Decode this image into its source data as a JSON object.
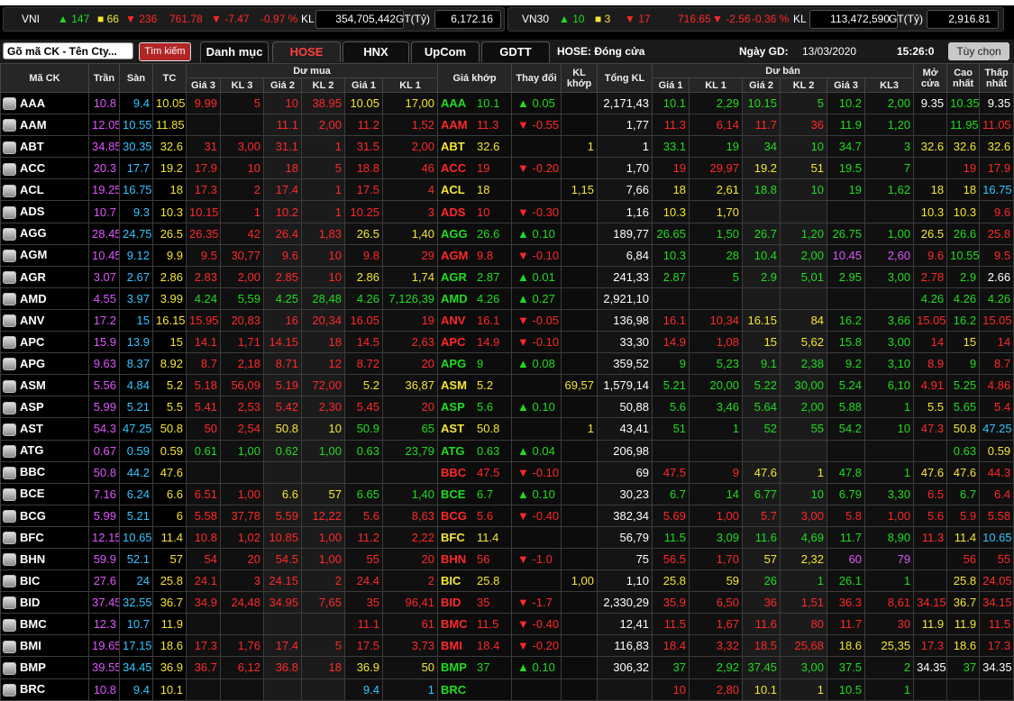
{
  "indices": [
    {
      "name": "VNI",
      "up": "147",
      "ref": "66",
      "down": "236",
      "value": "761.78",
      "change": "▼ -7.47",
      "pct": "-0.97 %",
      "kl_label": "KL",
      "volume": "354,705,442",
      "gt_label": "GT(Tỷ)",
      "gt": "6,172.16"
    },
    {
      "name": "VN30",
      "up": "10",
      "ref": "3",
      "down": "17",
      "value": "716.65",
      "change": "▼ -2.56",
      "pct": "-0.36 %",
      "kl_label": "KL",
      "volume": "113,472,590",
      "gt_label": "GT(Tỷ)",
      "gt": "2,916.81"
    }
  ],
  "toolbar": {
    "search_placeholder": "Gõ mã CK - Tên Cty...",
    "search_button": "Tìm kiếm",
    "tabs": [
      "Danh mục",
      "HOSE",
      "HNX",
      "UpCom",
      "GDTT"
    ],
    "active_tab": "HOSE",
    "status": "HOSE:  Đóng cửa",
    "date_label": "Ngày GD:",
    "date": "13/03/2020",
    "time": "15:26:0",
    "options_button": "Tùy chọn"
  },
  "headers": {
    "symbol": "Mã CK",
    "ceil": "Trần",
    "floor": "Sàn",
    "ref": "TC",
    "buy_group": "Dư mua",
    "sell_group": "Dư bán",
    "price": "Giá 3",
    "vol3": "KL 3",
    "price2": "Giá 2",
    "vol2": "KL 2",
    "price1": "Giá 1",
    "vol1": "KL 1",
    "match_price": "Giá khớp",
    "change": "Thay đổi",
    "match_vol": "KL khớp",
    "total_vol": "Tổng KL",
    "s_price1": "Giá 1",
    "s_vol1": "KL 1",
    "s_price2": "Giá 2",
    "s_vol2": "KL 2",
    "s_price3": "Giá 3",
    "s_vol3": "KL3",
    "open": "Mở cửa",
    "high": "Cao nhất",
    "low": "Thấp nhất"
  },
  "colors": {
    "up": "#1fdc1f",
    "down": "#ff2828",
    "ref": "#f5e633",
    "ceil": "#e055ff",
    "floor": "#33c5ff",
    "white": "#ffffff"
  },
  "rows": [
    {
      "s": "AAA",
      "c": "10.8",
      "f": "9.4",
      "r": "10.05",
      "b3": "9.99",
      "v3": "5",
      "b2": "10",
      "v2": "38.95",
      "b1": "10.05",
      "v1": "17,00",
      "p": "10.1",
      "ch": "▲ 0.05",
      "kl": "",
      "t": "2,171,43",
      "a1": "10.1",
      "w1": "2,29",
      "a2": "10.15",
      "w2": "5",
      "a3": "10.2",
      "w3": "2,00",
      "o": "9.35",
      "h": "10.35",
      "l": "9.35",
      "cs": "up",
      "cb3": "dn",
      "cb2": "dn",
      "cb1": "rf",
      "ca1": "up",
      "ca2": "up",
      "ca3": "up",
      "co": "wh",
      "chh": "up",
      "cl": "wh"
    },
    {
      "s": "AAM",
      "c": "12.05",
      "f": "10.55",
      "r": "11.85",
      "b3": "",
      "v3": "",
      "b2": "11.1",
      "v2": "2,00",
      "b1": "11.2",
      "v1": "1,52",
      "p": "11.3",
      "ch": "▼ -0.55",
      "kl": "",
      "t": "1,77",
      "a1": "11.3",
      "w1": "6,14",
      "a2": "11.7",
      "w2": "36",
      "a3": "11.9",
      "w3": "1,20",
      "o": "",
      "h": "11.95",
      "l": "11.05",
      "cs": "dn",
      "cb3": "dn",
      "cb2": "dn",
      "cb1": "dn",
      "ca1": "dn",
      "ca2": "dn",
      "ca3": "up",
      "co": "wh",
      "chh": "up",
      "cl": "dn"
    },
    {
      "s": "ABT",
      "c": "34.85",
      "f": "30.35",
      "r": "32.6",
      "b3": "31",
      "v3": "3,00",
      "b2": "31.1",
      "v2": "1",
      "b1": "31.5",
      "v1": "2,00",
      "p": "32.6",
      "ch": "",
      "kl": "1",
      "t": "1",
      "a1": "33.1",
      "w1": "19",
      "a2": "34",
      "w2": "10",
      "a3": "34.7",
      "w3": "3",
      "o": "32.6",
      "h": "32.6",
      "l": "32.6",
      "cs": "rf",
      "cb3": "dn",
      "cb2": "dn",
      "cb1": "dn",
      "ca1": "up",
      "ca2": "up",
      "ca3": "up",
      "co": "rf",
      "chh": "rf",
      "cl": "rf"
    },
    {
      "s": "ACC",
      "c": "20.3",
      "f": "17.7",
      "r": "19.2",
      "b3": "17.9",
      "v3": "10",
      "b2": "18",
      "v2": "5",
      "b1": "18.8",
      "v1": "46",
      "p": "19",
      "ch": "▼ -0.20",
      "kl": "",
      "t": "1,70",
      "a1": "19",
      "w1": "29,97",
      "a2": "19.2",
      "w2": "51",
      "a3": "19.5",
      "w3": "7",
      "o": "",
      "h": "19",
      "l": "17.9",
      "cs": "dn",
      "cb3": "dn",
      "cb2": "dn",
      "cb1": "dn",
      "ca1": "dn",
      "ca2": "rf",
      "ca3": "up",
      "co": "wh",
      "chh": "dn",
      "cl": "dn"
    },
    {
      "s": "ACL",
      "c": "19.25",
      "f": "16.75",
      "r": "18",
      "b3": "17.3",
      "v3": "2",
      "b2": "17.4",
      "v2": "1",
      "b1": "17.5",
      "v1": "4",
      "p": "18",
      "ch": "",
      "kl": "1,15",
      "t": "7,66",
      "a1": "18",
      "w1": "2,61",
      "a2": "18.8",
      "w2": "10",
      "a3": "19",
      "w3": "1,62",
      "o": "18",
      "h": "18",
      "l": "16.75",
      "cs": "rf",
      "cb3": "dn",
      "cb2": "dn",
      "cb1": "dn",
      "ca1": "rf",
      "ca2": "up",
      "ca3": "up",
      "co": "rf",
      "chh": "rf",
      "cl": "fl"
    },
    {
      "s": "ADS",
      "c": "10.7",
      "f": "9.3",
      "r": "10.3",
      "b3": "10.15",
      "v3": "1",
      "b2": "10.2",
      "v2": "1",
      "b1": "10.25",
      "v1": "3",
      "p": "10",
      "ch": "▼ -0.30",
      "kl": "",
      "t": "1,16",
      "a1": "10.3",
      "w1": "1,70",
      "a2": "",
      "w2": "",
      "a3": "",
      "w3": "",
      "o": "10.3",
      "h": "10.3",
      "l": "9.6",
      "cs": "dn",
      "cb3": "dn",
      "cb2": "dn",
      "cb1": "dn",
      "ca1": "rf",
      "ca2": "wh",
      "ca3": "wh",
      "co": "rf",
      "chh": "rf",
      "cl": "dn"
    },
    {
      "s": "AGG",
      "c": "28.45",
      "f": "24.75",
      "r": "26.5",
      "b3": "26.35",
      "v3": "42",
      "b2": "26.4",
      "v2": "1,83",
      "b1": "26.5",
      "v1": "1,40",
      "p": "26.6",
      "ch": "▲ 0.10",
      "kl": "",
      "t": "189,77",
      "a1": "26.65",
      "w1": "1,50",
      "a2": "26.7",
      "w2": "1,20",
      "a3": "26.75",
      "w3": "1,00",
      "o": "26.5",
      "h": "26.6",
      "l": "25.8",
      "cs": "up",
      "cb3": "dn",
      "cb2": "dn",
      "cb1": "rf",
      "ca1": "up",
      "ca2": "up",
      "ca3": "up",
      "co": "rf",
      "chh": "up",
      "cl": "dn"
    },
    {
      "s": "AGM",
      "c": "10.45",
      "f": "9.12",
      "r": "9.9",
      "b3": "9.5",
      "v3": "30,77",
      "b2": "9.6",
      "v2": "10",
      "b1": "9.8",
      "v1": "29",
      "p": "9.8",
      "ch": "▼ -0.10",
      "kl": "",
      "t": "6,84",
      "a1": "10.3",
      "w1": "28",
      "a2": "10.4",
      "w2": "2,00",
      "a3": "10.45",
      "w3": "2,60",
      "o": "9.6",
      "h": "10.55",
      "l": "9.5",
      "cs": "dn",
      "cb3": "dn",
      "cb2": "dn",
      "cb1": "dn",
      "ca1": "up",
      "ca2": "up",
      "ca3": "ce",
      "co": "dn",
      "chh": "up",
      "cl": "dn"
    },
    {
      "s": "AGR",
      "c": "3.07",
      "f": "2.67",
      "r": "2.86",
      "b3": "2.83",
      "v3": "2,00",
      "b2": "2.85",
      "v2": "10",
      "b1": "2.86",
      "v1": "1,74",
      "p": "2.87",
      "ch": "▲ 0.01",
      "kl": "",
      "t": "241,33",
      "a1": "2.87",
      "w1": "5",
      "a2": "2.9",
      "w2": "5,01",
      "a3": "2.95",
      "w3": "3,00",
      "o": "2.78",
      "h": "2.9",
      "l": "2.66",
      "cs": "up",
      "cb3": "dn",
      "cb2": "dn",
      "cb1": "rf",
      "ca1": "up",
      "ca2": "up",
      "ca3": "up",
      "co": "dn",
      "chh": "up",
      "cl": "wh"
    },
    {
      "s": "AMD",
      "c": "4.55",
      "f": "3.97",
      "r": "3.99",
      "b3": "4.24",
      "v3": "5,59",
      "b2": "4.25",
      "v2": "28,48",
      "b1": "4.26",
      "v1": "7,126,39",
      "p": "4.26",
      "ch": "▲ 0.27",
      "kl": "",
      "t": "2,921,10",
      "a1": "",
      "w1": "",
      "a2": "",
      "w2": "",
      "a3": "",
      "w3": "",
      "o": "4.26",
      "h": "4.26",
      "l": "4.26",
      "cs": "up",
      "cb3": "up",
      "cb2": "up",
      "cb1": "up",
      "ca1": "wh",
      "ca2": "wh",
      "ca3": "wh",
      "co": "up",
      "chh": "up",
      "cl": "up"
    },
    {
      "s": "ANV",
      "c": "17.2",
      "f": "15",
      "r": "16.15",
      "b3": "15.95",
      "v3": "20,83",
      "b2": "16",
      "v2": "20,34",
      "b1": "16.05",
      "v1": "19",
      "p": "16.1",
      "ch": "▼ -0.05",
      "kl": "",
      "t": "136,98",
      "a1": "16.1",
      "w1": "10,34",
      "a2": "16.15",
      "w2": "84",
      "a3": "16.2",
      "w3": "3,66",
      "o": "15.05",
      "h": "16.2",
      "l": "15.05",
      "cs": "dn",
      "cb3": "dn",
      "cb2": "dn",
      "cb1": "dn",
      "ca1": "dn",
      "ca2": "rf",
      "ca3": "up",
      "co": "dn",
      "chh": "up",
      "cl": "dn"
    },
    {
      "s": "APC",
      "c": "15.9",
      "f": "13.9",
      "r": "15",
      "b3": "14.1",
      "v3": "1,71",
      "b2": "14.15",
      "v2": "18",
      "b1": "14.5",
      "v1": "2,63",
      "p": "14.9",
      "ch": "▼ -0.10",
      "kl": "",
      "t": "33,30",
      "a1": "14.9",
      "w1": "1,08",
      "a2": "15",
      "w2": "5,62",
      "a3": "15.8",
      "w3": "3,00",
      "o": "14",
      "h": "15",
      "l": "14",
      "cs": "dn",
      "cb3": "dn",
      "cb2": "dn",
      "cb1": "dn",
      "ca1": "dn",
      "ca2": "rf",
      "ca3": "up",
      "co": "dn",
      "chh": "rf",
      "cl": "dn"
    },
    {
      "s": "APG",
      "c": "9.63",
      "f": "8.37",
      "r": "8.92",
      "b3": "8.7",
      "v3": "2,18",
      "b2": "8.71",
      "v2": "12",
      "b1": "8.72",
      "v1": "20",
      "p": "9",
      "ch": "▲ 0.08",
      "kl": "",
      "t": "359,52",
      "a1": "9",
      "w1": "5,23",
      "a2": "9.1",
      "w2": "2,38",
      "a3": "9.2",
      "w3": "3,10",
      "o": "8.9",
      "h": "9",
      "l": "8.7",
      "cs": "up",
      "cb3": "dn",
      "cb2": "dn",
      "cb1": "dn",
      "ca1": "up",
      "ca2": "up",
      "ca3": "up",
      "co": "dn",
      "chh": "up",
      "cl": "dn"
    },
    {
      "s": "ASM",
      "c": "5.56",
      "f": "4.84",
      "r": "5.2",
      "b3": "5.18",
      "v3": "56,09",
      "b2": "5.19",
      "v2": "72,00",
      "b1": "5.2",
      "v1": "36,87",
      "p": "5.2",
      "ch": "",
      "kl": "69,57",
      "t": "1,579,14",
      "a1": "5.21",
      "w1": "20,00",
      "a2": "5.22",
      "w2": "30,00",
      "a3": "5.24",
      "w3": "6,10",
      "o": "4.91",
      "h": "5.25",
      "l": "4.86",
      "cs": "rf",
      "cb3": "dn",
      "cb2": "dn",
      "cb1": "rf",
      "ca1": "up",
      "ca2": "up",
      "ca3": "up",
      "co": "dn",
      "chh": "up",
      "cl": "dn"
    },
    {
      "s": "ASP",
      "c": "5.99",
      "f": "5.21",
      "r": "5.5",
      "b3": "5.41",
      "v3": "2,53",
      "b2": "5.42",
      "v2": "2,30",
      "b1": "5.45",
      "v1": "20",
      "p": "5.6",
      "ch": "▲ 0.10",
      "kl": "",
      "t": "50,88",
      "a1": "5.6",
      "w1": "3,46",
      "a2": "5.64",
      "w2": "2,00",
      "a3": "5.88",
      "w3": "1",
      "o": "5.5",
      "h": "5.65",
      "l": "5.4",
      "cs": "up",
      "cb3": "dn",
      "cb2": "dn",
      "cb1": "dn",
      "ca1": "up",
      "ca2": "up",
      "ca3": "up",
      "co": "rf",
      "chh": "up",
      "cl": "dn"
    },
    {
      "s": "AST",
      "c": "54.3",
      "f": "47.25",
      "r": "50.8",
      "b3": "50",
      "v3": "2,54",
      "b2": "50.8",
      "v2": "10",
      "b1": "50.9",
      "v1": "65",
      "p": "50.8",
      "ch": "",
      "kl": "1",
      "t": "43,41",
      "a1": "51",
      "w1": "1",
      "a2": "52",
      "w2": "55",
      "a3": "54.2",
      "w3": "10",
      "o": "47.3",
      "h": "50.8",
      "l": "47.25",
      "cs": "rf",
      "cb3": "dn",
      "cb2": "rf",
      "cb1": "up",
      "ca1": "up",
      "ca2": "up",
      "ca3": "up",
      "co": "dn",
      "chh": "rf",
      "cl": "fl"
    },
    {
      "s": "ATG",
      "c": "0.67",
      "f": "0.59",
      "r": "0.59",
      "b3": "0.61",
      "v3": "1,00",
      "b2": "0.62",
      "v2": "1,00",
      "b1": "0.63",
      "v1": "23,79",
      "p": "0.63",
      "ch": "▲ 0.04",
      "kl": "",
      "t": "206,98",
      "a1": "",
      "w1": "",
      "a2": "",
      "w2": "",
      "a3": "",
      "w3": "",
      "o": "",
      "h": "0.63",
      "l": "0.59",
      "cs": "up",
      "cb3": "up",
      "cb2": "up",
      "cb1": "up",
      "ca1": "wh",
      "ca2": "wh",
      "ca3": "wh",
      "co": "wh",
      "chh": "up",
      "cl": "rf"
    },
    {
      "s": "BBC",
      "c": "50.8",
      "f": "44.2",
      "r": "47.6",
      "b3": "",
      "v3": "",
      "b2": "",
      "v2": "",
      "b1": "",
      "v1": "",
      "p": "47.5",
      "ch": "▼ -0.10",
      "kl": "",
      "t": "69",
      "a1": "47.5",
      "w1": "9",
      "a2": "47.6",
      "w2": "1",
      "a3": "47.8",
      "w3": "1",
      "o": "47.6",
      "h": "47.6",
      "l": "44.3",
      "cs": "dn",
      "cb3": "wh",
      "cb2": "wh",
      "cb1": "wh",
      "ca1": "dn",
      "ca2": "rf",
      "ca3": "up",
      "co": "rf",
      "chh": "rf",
      "cl": "dn"
    },
    {
      "s": "BCE",
      "c": "7.16",
      "f": "6.24",
      "r": "6.6",
      "b3": "6.51",
      "v3": "1,00",
      "b2": "6.6",
      "v2": "57",
      "b1": "6.65",
      "v1": "1,40",
      "p": "6.7",
      "ch": "▲ 0.10",
      "kl": "",
      "t": "30,23",
      "a1": "6.7",
      "w1": "14",
      "a2": "6.77",
      "w2": "10",
      "a3": "6.79",
      "w3": "3,30",
      "o": "6.5",
      "h": "6.7",
      "l": "6.4",
      "cs": "up",
      "cb3": "dn",
      "cb2": "rf",
      "cb1": "up",
      "ca1": "up",
      "ca2": "up",
      "ca3": "up",
      "co": "dn",
      "chh": "up",
      "cl": "dn"
    },
    {
      "s": "BCG",
      "c": "5.99",
      "f": "5.21",
      "r": "6",
      "b3": "5.58",
      "v3": "37,78",
      "b2": "5.59",
      "v2": "12,22",
      "b1": "5.6",
      "v1": "8,63",
      "p": "5.6",
      "ch": "▼ -0.40",
      "kl": "",
      "t": "382,34",
      "a1": "5.69",
      "w1": "1,00",
      "a2": "5.7",
      "w2": "3,00",
      "a3": "5.8",
      "w3": "1,00",
      "o": "5.6",
      "h": "5.9",
      "l": "5.58",
      "cs": "dn",
      "cb3": "dn",
      "cb2": "dn",
      "cb1": "dn",
      "ca1": "dn",
      "ca2": "dn",
      "ca3": "dn",
      "co": "dn",
      "chh": "dn",
      "cl": "dn"
    },
    {
      "s": "BFC",
      "c": "12.15",
      "f": "10.65",
      "r": "11.4",
      "b3": "10.8",
      "v3": "1,02",
      "b2": "10.85",
      "v2": "1,00",
      "b1": "11.2",
      "v1": "2,22",
      "p": "11.4",
      "ch": "",
      "kl": "",
      "t": "56,79",
      "a1": "11.5",
      "w1": "3,09",
      "a2": "11.6",
      "w2": "4,69",
      "a3": "11.7",
      "w3": "8,90",
      "o": "11.3",
      "h": "11.4",
      "l": "10.65",
      "cs": "rf",
      "cb3": "dn",
      "cb2": "dn",
      "cb1": "dn",
      "ca1": "up",
      "ca2": "up",
      "ca3": "up",
      "co": "dn",
      "chh": "rf",
      "cl": "fl"
    },
    {
      "s": "BHN",
      "c": "59.9",
      "f": "52.1",
      "r": "57",
      "b3": "54",
      "v3": "20",
      "b2": "54.5",
      "v2": "1,00",
      "b1": "55",
      "v1": "20",
      "p": "56",
      "ch": "▼ -1.0",
      "kl": "",
      "t": "75",
      "a1": "56.5",
      "w1": "1,70",
      "a2": "57",
      "w2": "2,32",
      "a3": "60",
      "w3": "79",
      "o": "",
      "h": "56",
      "l": "55",
      "cs": "dn",
      "cb3": "dn",
      "cb2": "dn",
      "cb1": "dn",
      "ca1": "dn",
      "ca2": "rf",
      "ca3": "ce",
      "co": "wh",
      "chh": "dn",
      "cl": "dn"
    },
    {
      "s": "BIC",
      "c": "27.6",
      "f": "24",
      "r": "25.8",
      "b3": "24.1",
      "v3": "3",
      "b2": "24.15",
      "v2": "2",
      "b1": "24.4",
      "v1": "2",
      "p": "25.8",
      "ch": "",
      "kl": "1,00",
      "t": "1,10",
      "a1": "25.8",
      "w1": "59",
      "a2": "26",
      "w2": "1",
      "a3": "26.1",
      "w3": "1",
      "o": "",
      "h": "25.8",
      "l": "24.05",
      "cs": "rf",
      "cb3": "dn",
      "cb2": "dn",
      "cb1": "dn",
      "ca1": "rf",
      "ca2": "up",
      "ca3": "up",
      "co": "wh",
      "chh": "rf",
      "cl": "dn"
    },
    {
      "s": "BID",
      "c": "37.45",
      "f": "32.55",
      "r": "36.7",
      "b3": "34.9",
      "v3": "24,48",
      "b2": "34.95",
      "v2": "7,65",
      "b1": "35",
      "v1": "96,41",
      "p": "35",
      "ch": "▼ -1.7",
      "kl": "",
      "t": "2,330,29",
      "a1": "35.9",
      "w1": "6,50",
      "a2": "36",
      "w2": "1,51",
      "a3": "36.3",
      "w3": "8,61",
      "o": "34.15",
      "h": "36.7",
      "l": "34.15",
      "cs": "dn",
      "cb3": "dn",
      "cb2": "dn",
      "cb1": "dn",
      "ca1": "dn",
      "ca2": "dn",
      "ca3": "dn",
      "co": "dn",
      "chh": "rf",
      "cl": "dn"
    },
    {
      "s": "BMC",
      "c": "12.3",
      "f": "10.7",
      "r": "11.9",
      "b3": "",
      "v3": "",
      "b2": "",
      "v2": "",
      "b1": "11.1",
      "v1": "61",
      "p": "11.5",
      "ch": "▼ -0.40",
      "kl": "",
      "t": "12,41",
      "a1": "11.5",
      "w1": "1,67",
      "a2": "11.6",
      "w2": "80",
      "a3": "11.7",
      "w3": "30",
      "o": "11.9",
      "h": "11.9",
      "l": "11.5",
      "cs": "dn",
      "cb3": "wh",
      "cb2": "wh",
      "cb1": "dn",
      "ca1": "dn",
      "ca2": "dn",
      "ca3": "dn",
      "co": "rf",
      "chh": "rf",
      "cl": "dn"
    },
    {
      "s": "BMI",
      "c": "19.65",
      "f": "17.15",
      "r": "18.6",
      "b3": "17.3",
      "v3": "1,76",
      "b2": "17.4",
      "v2": "5",
      "b1": "17.5",
      "v1": "3,73",
      "p": "18.4",
      "ch": "▼ -0.20",
      "kl": "",
      "t": "116,83",
      "a1": "18.4",
      "w1": "3,32",
      "a2": "18.5",
      "w2": "25,68",
      "a3": "18.6",
      "w3": "25,35",
      "o": "17.3",
      "h": "18.6",
      "l": "17.3",
      "cs": "dn",
      "cb3": "dn",
      "cb2": "dn",
      "cb1": "dn",
      "ca1": "dn",
      "ca2": "dn",
      "ca3": "rf",
      "co": "dn",
      "chh": "rf",
      "cl": "dn"
    },
    {
      "s": "BMP",
      "c": "39.55",
      "f": "34.45",
      "r": "36.9",
      "b3": "36.7",
      "v3": "6,12",
      "b2": "36.8",
      "v2": "18",
      "b1": "36.9",
      "v1": "50",
      "p": "37",
      "ch": "▲ 0.10",
      "kl": "",
      "t": "306,32",
      "a1": "37",
      "w1": "2,92",
      "a2": "37.45",
      "w2": "3,00",
      "a3": "37.5",
      "w3": "2",
      "o": "34.35",
      "h": "37",
      "l": "34.35",
      "cs": "up",
      "cb3": "dn",
      "cb2": "dn",
      "cb1": "rf",
      "ca1": "up",
      "ca2": "up",
      "ca3": "up",
      "co": "wh",
      "chh": "up",
      "cl": "wh"
    },
    {
      "s": "BRC",
      "c": "10.8",
      "f": "9.4",
      "r": "10.1",
      "b3": "",
      "v3": "",
      "b2": "",
      "v2": "",
      "b1": "9.4",
      "v1": "1",
      "p": "",
      "ch": "",
      "kl": "",
      "t": "",
      "a1": "10",
      "w1": "2,80",
      "a2": "10.1",
      "w2": "1",
      "a3": "10.5",
      "w3": "1",
      "o": "",
      "h": "",
      "l": "",
      "cs": "up",
      "cb3": "wh",
      "cb2": "wh",
      "cb1": "fl",
      "ca1": "dn",
      "ca2": "rf",
      "ca3": "up",
      "co": "wh",
      "chh": "wh",
      "cl": "wh"
    }
  ]
}
